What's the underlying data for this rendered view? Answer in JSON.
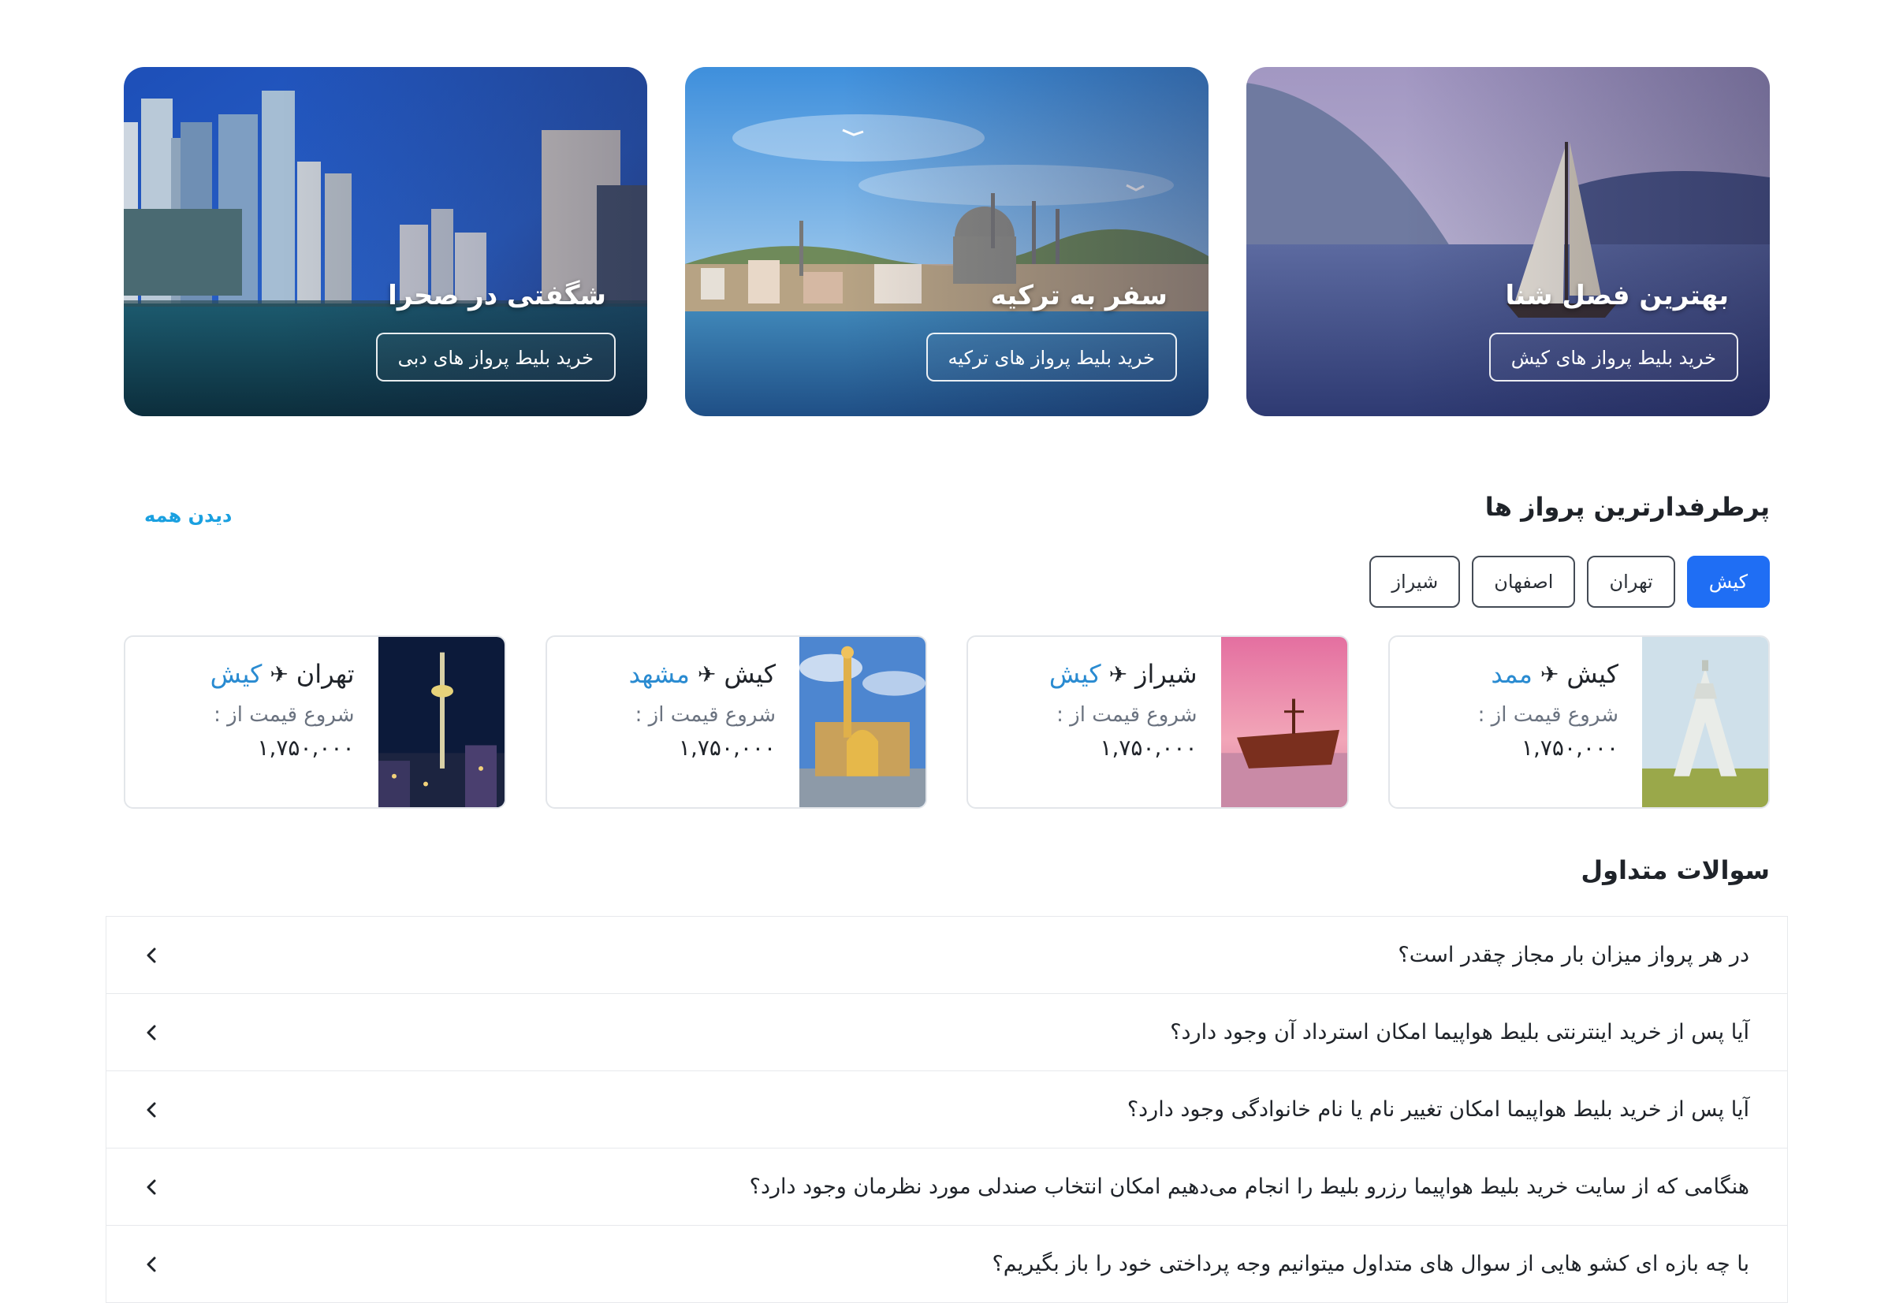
{
  "promos": [
    {
      "title": "شگفتی در صحرا",
      "button": "خرید بلیط پرواز های دبی"
    },
    {
      "title": "سفر به ترکیه",
      "button": "خرید بلیط پرواز های ترکیه"
    },
    {
      "title": "بهترین فصل شنا",
      "button": "خرید بلیط پرواز های کیش"
    }
  ],
  "popular": {
    "title": "پرطرفدارترین پرواز ها",
    "see_all": "دیدن همه",
    "filters": [
      "کیش",
      "تهران",
      "اصفهان",
      "شیراز"
    ],
    "active_filter": "کیش",
    "routes": [
      {
        "from": "کیش",
        "to": "ممد",
        "price_label": "شروع قیمت از :",
        "price": "۱,۷۵۰,۰۰۰",
        "image_icon": "azadi-tower-image"
      },
      {
        "from": "شیراز",
        "to": "کیش",
        "price_label": "شروع قیمت از :",
        "price": "۱,۷۵۰,۰۰۰",
        "image_icon": "shipwreck-image"
      },
      {
        "from": "کیش",
        "to": "مشهد",
        "price_label": "شروع قیمت از :",
        "price": "۱,۷۵۰,۰۰۰",
        "image_icon": "shrine-image"
      },
      {
        "from": "تهران",
        "to": "کیش",
        "price_label": "شروع قیمت از :",
        "price": "۱,۷۵۰,۰۰۰",
        "image_icon": "milad-tower-image"
      }
    ]
  },
  "faq": {
    "title": "سوالات متداول",
    "items": [
      "در هر پرواز میزان بار مجاز چقدر است؟",
      "آیا پس از خرید اینترنتی بلیط هواپیما امکان استرداد آن وجود دارد؟",
      "آیا پس از خرید بلیط هواپیما امکان تغییر نام یا نام خانوادگی وجود دارد؟",
      "هنگامی که از سایت خرید بلیط هواپیما رزرو بلیط را انجام می‌دهیم امکان انتخاب صندلی مورد نظرمان وجود دارد؟",
      "با چه بازه ای کشو هایی از سوال های متداول میتوانیم وجه پرداختی خود را باز بگیریم؟"
    ]
  },
  "colors": {
    "accent": "#1f6ef4",
    "link": "#1aa0e0",
    "route_dest": "#2a8bd1"
  }
}
